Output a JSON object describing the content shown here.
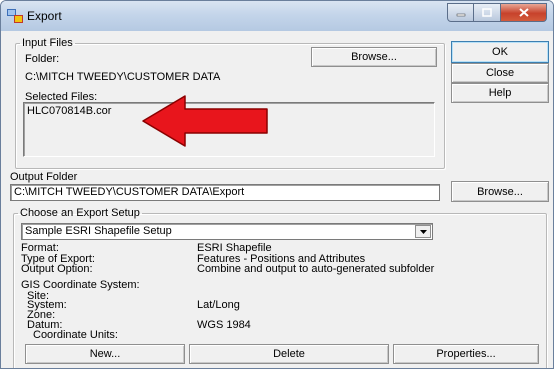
{
  "window": {
    "title": "Export",
    "icon": "export-app-icon"
  },
  "input_files": {
    "legend": "Input Files",
    "folder_label": "Folder:",
    "browse_label": "Browse...",
    "folder_value": "C:\\MITCH TWEEDY\\CUSTOMER DATA",
    "selected_label": "Selected Files:",
    "selected_files": [
      "HLC070814B.cor"
    ]
  },
  "side_buttons": {
    "ok": "OK",
    "close": "Close",
    "help": "Help"
  },
  "output_folder": {
    "label": "Output Folder",
    "value": "C:\\MITCH TWEEDY\\CUSTOMER DATA\\Export",
    "browse_label": "Browse..."
  },
  "export_setup": {
    "legend": "Choose an Export Setup",
    "selected_setup": "Sample ESRI Shapefile Setup",
    "format_label": "Format:",
    "format_value": "ESRI Shapefile",
    "type_label": "Type of Export:",
    "type_value": "Features - Positions and Attributes",
    "output_option_label": "Output Option:",
    "output_option_value": "Combine and output to auto-generated subfolder",
    "gis_label": "GIS Coordinate System:",
    "site_label": "Site:",
    "site_value": "",
    "system_label": "System:",
    "system_value": "Lat/Long",
    "zone_label": "Zone:",
    "zone_value": "",
    "datum_label": "Datum:",
    "datum_value": "WGS 1984",
    "units_label": "Coordinate Units:",
    "units_value": "",
    "new_label": "New...",
    "delete_label": "Delete",
    "properties_label": "Properties..."
  },
  "annotation": {
    "arrow_color": "#e8151c",
    "arrow_icon": "red-pointer-arrow"
  }
}
